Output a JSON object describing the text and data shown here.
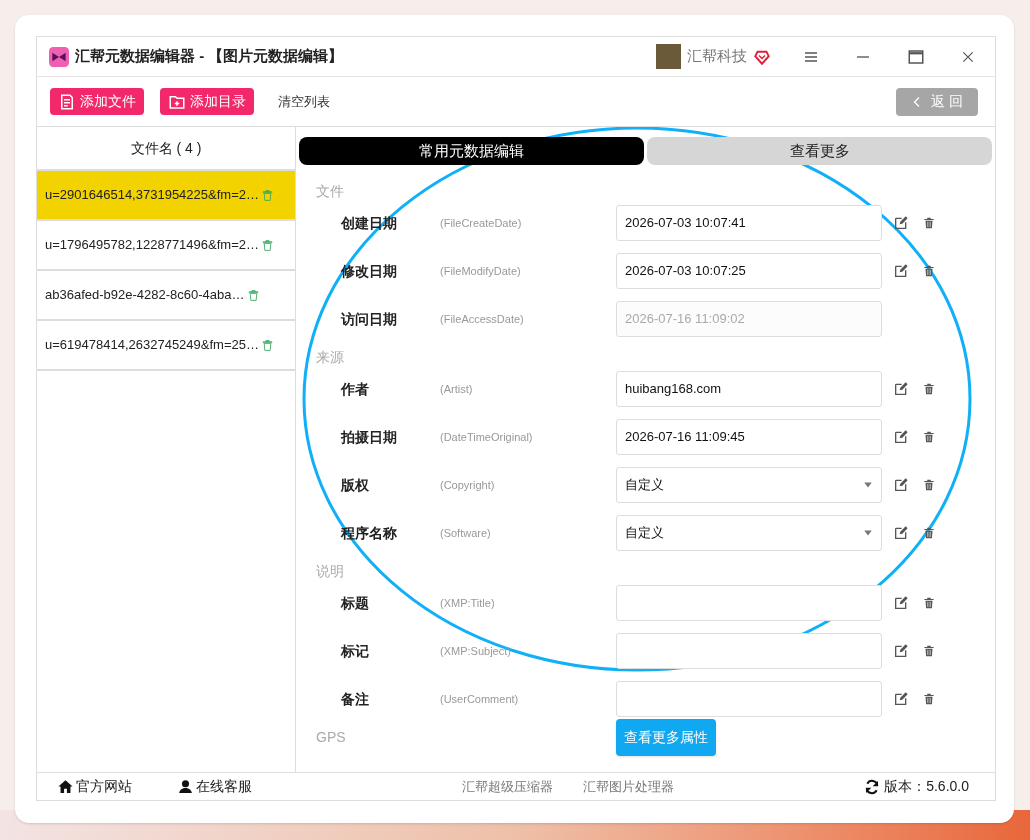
{
  "window": {
    "title": "汇帮元数据编辑器 - 【图片元数据编辑】",
    "brand": "汇帮科技"
  },
  "toolbar": {
    "buttons": [
      {
        "kind": "file",
        "label": "添加文件"
      },
      {
        "kind": "folder",
        "label": "添加目录"
      }
    ],
    "clear_label": "清空列表",
    "back_label": "返 回"
  },
  "file_list": {
    "header": "文件名 ( 4 )",
    "items": [
      {
        "name": "u=2901646514,3731954225&fm=2…",
        "selected": true
      },
      {
        "name": "u=1796495782,1228771496&fm=2…",
        "selected": false
      },
      {
        "name": "ab36afed-b92e-4282-8c60-4aba…",
        "selected": false
      },
      {
        "name": "u=619478414,2632745249&fm=25…",
        "selected": false
      }
    ]
  },
  "tabs": [
    {
      "label": "常用元数据编辑",
      "selected": true
    },
    {
      "label": "查看更多",
      "selected": false
    }
  ],
  "sections": [
    {
      "title": "文件",
      "fields": [
        {
          "label": "创建日期",
          "tag": "(FileCreateDate)",
          "kind": "text",
          "value": "2026-07-03 10:07:41",
          "disabled": false
        },
        {
          "label": "修改日期",
          "tag": "(FileModifyDate)",
          "kind": "text",
          "value": "2026-07-03 10:07:25",
          "disabled": false
        },
        {
          "label": "访问日期",
          "tag": "(FileAccessDate)",
          "kind": "text",
          "value": "2026-07-16 11:09:02",
          "disabled": true
        }
      ]
    },
    {
      "title": "来源",
      "fields": [
        {
          "label": "作者",
          "tag": "(Artist)",
          "kind": "text",
          "value": "huibang168.com",
          "disabled": false
        },
        {
          "label": "拍摄日期",
          "tag": "(DateTimeOriginal)",
          "kind": "text",
          "value": "2026-07-16 11:09:45",
          "disabled": false
        },
        {
          "label": "版权",
          "tag": "(Copyright)",
          "kind": "select",
          "value": "自定义",
          "disabled": false
        },
        {
          "label": "程序名称",
          "tag": "(Software)",
          "kind": "select",
          "value": "自定义",
          "disabled": false
        }
      ]
    },
    {
      "title": "说明",
      "fields": [
        {
          "label": "标题",
          "tag": "(XMP:Title)",
          "kind": "text",
          "disabled": false
        },
        {
          "label": "标记",
          "tag": "(XMP:Subject)",
          "kind": "text",
          "disabled": false
        },
        {
          "label": "备注",
          "tag": "(UserComment)",
          "kind": "text",
          "disabled": false
        }
      ]
    },
    {
      "title": "GPS"
    }
  ],
  "more_button": "查看更多属性",
  "footer": {
    "links": [
      {
        "kind": "home",
        "label": "官方网站"
      },
      {
        "kind": "support",
        "label": "在线客服"
      }
    ],
    "products": [
      "汇帮超级压缩器",
      "汇帮图片处理器"
    ],
    "version": "版本：5.6.0.0"
  }
}
